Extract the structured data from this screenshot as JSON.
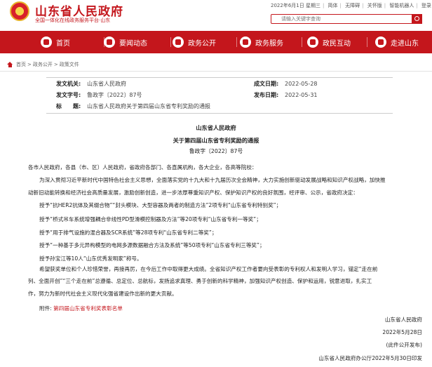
{
  "header": {
    "site_title": "山东省人民政府",
    "site_subtitle": "全国一体化在线政务服务平台·山东",
    "top_links": [
      "2022年6月1日 星期三",
      "简体",
      "无障碍",
      "关怀版",
      "智能机器人",
      "登录"
    ],
    "search_placeholder": "请输入关键字查询"
  },
  "nav": {
    "items": [
      {
        "label": "首页",
        "icon": "home-icon"
      },
      {
        "label": "要闻动态",
        "icon": "news-icon"
      },
      {
        "label": "政务公开",
        "icon": "document-icon"
      },
      {
        "label": "政务服务",
        "icon": "service-icon"
      },
      {
        "label": "政民互动",
        "icon": "chat-icon"
      },
      {
        "label": "走进山东",
        "icon": "location-icon"
      }
    ],
    "color": "#c4161c"
  },
  "breadcrumb": {
    "items": [
      "首页",
      "政务公开",
      "政策文件"
    ],
    "separator": ">"
  },
  "meta": {
    "issuer_label": "发文机关:",
    "issuer": "山东省人民政府",
    "written_date_label": "成文日期:",
    "written_date": "2022-05-28",
    "doc_no_label": "发文字号:",
    "doc_no": "鲁政字〔2022〕87号",
    "publish_date_label": "发布日期:",
    "publish_date": "2022-05-31",
    "title_label": "标　　题:",
    "title": "山东省人民政府关于第四届山东省专利奖励的通报"
  },
  "document": {
    "org": "山东省人民政府",
    "title": "关于第四届山东省专利奖励的通报",
    "doc_no": "鲁政字〔2022〕87号",
    "recipients": "各市人民政府，各县（市、区）人民政府，省政府各部门、各直属机构，各大企业，各高等院校：",
    "intro_line1": "为深入贯彻习近平新时代中国特色社会主义思想，全面落实党的十九大和十九届历次全会精神，大力实施创新驱动发展战略和知识产权战略，加快推",
    "intro_line2": "动新旧动能转换和经济社会高质量发展，激励创新创造，进一步浓厚尊重知识产权、保护知识产权的良好氛围，经评审、公示，省政府决定：",
    "awards": [
      "授予“抗HER2抗体及其缀合物”“封头模块、大型容器及两者的制造方法”2项专利“山东省专利特别奖”；",
      "授予“桥式吊车系统增强耦合非线性PD型滑模控制器及方法”等20项专利“山东省专利一等奖”；",
      "授予“用于排气设施的混合器及SCR系统”等28项专利“山东省专利二等奖”；",
      "授予“一种基于多元异构模型的电网多源数据融合方法及系统”等50项专利“山东省专利三等奖”；",
      "授予孙宝江等10人“山东优秀发明家”称号。"
    ],
    "closing_line1": "希望获奖单位和个人珍惜荣誉，再接再厉，在今后工作中取得更大成绩。全省知识产权工作者要向受表彰的专利权人和发明人学习，锚定“走在前",
    "closing_line2": "列、全面开创”“三个走在前”总遵循、总定位、总航标，发扬追求真理、勇于创新的科学精神，加强知识产权创造、保护和运用，锐意进取，扎实工",
    "closing_line3": "作，努力为新时代社会主义现代化强省建设作出新的更大贡献。",
    "attachment_label": "附件:",
    "attachment_link": "第四届山东省专利奖表彰名单",
    "sign_org": "山东省人民政府",
    "sign_date": "2022年5月28日",
    "public_note": "(此件公开发布)",
    "footer_org": "山东省人民政府办公厅2022年5月30日印发"
  }
}
